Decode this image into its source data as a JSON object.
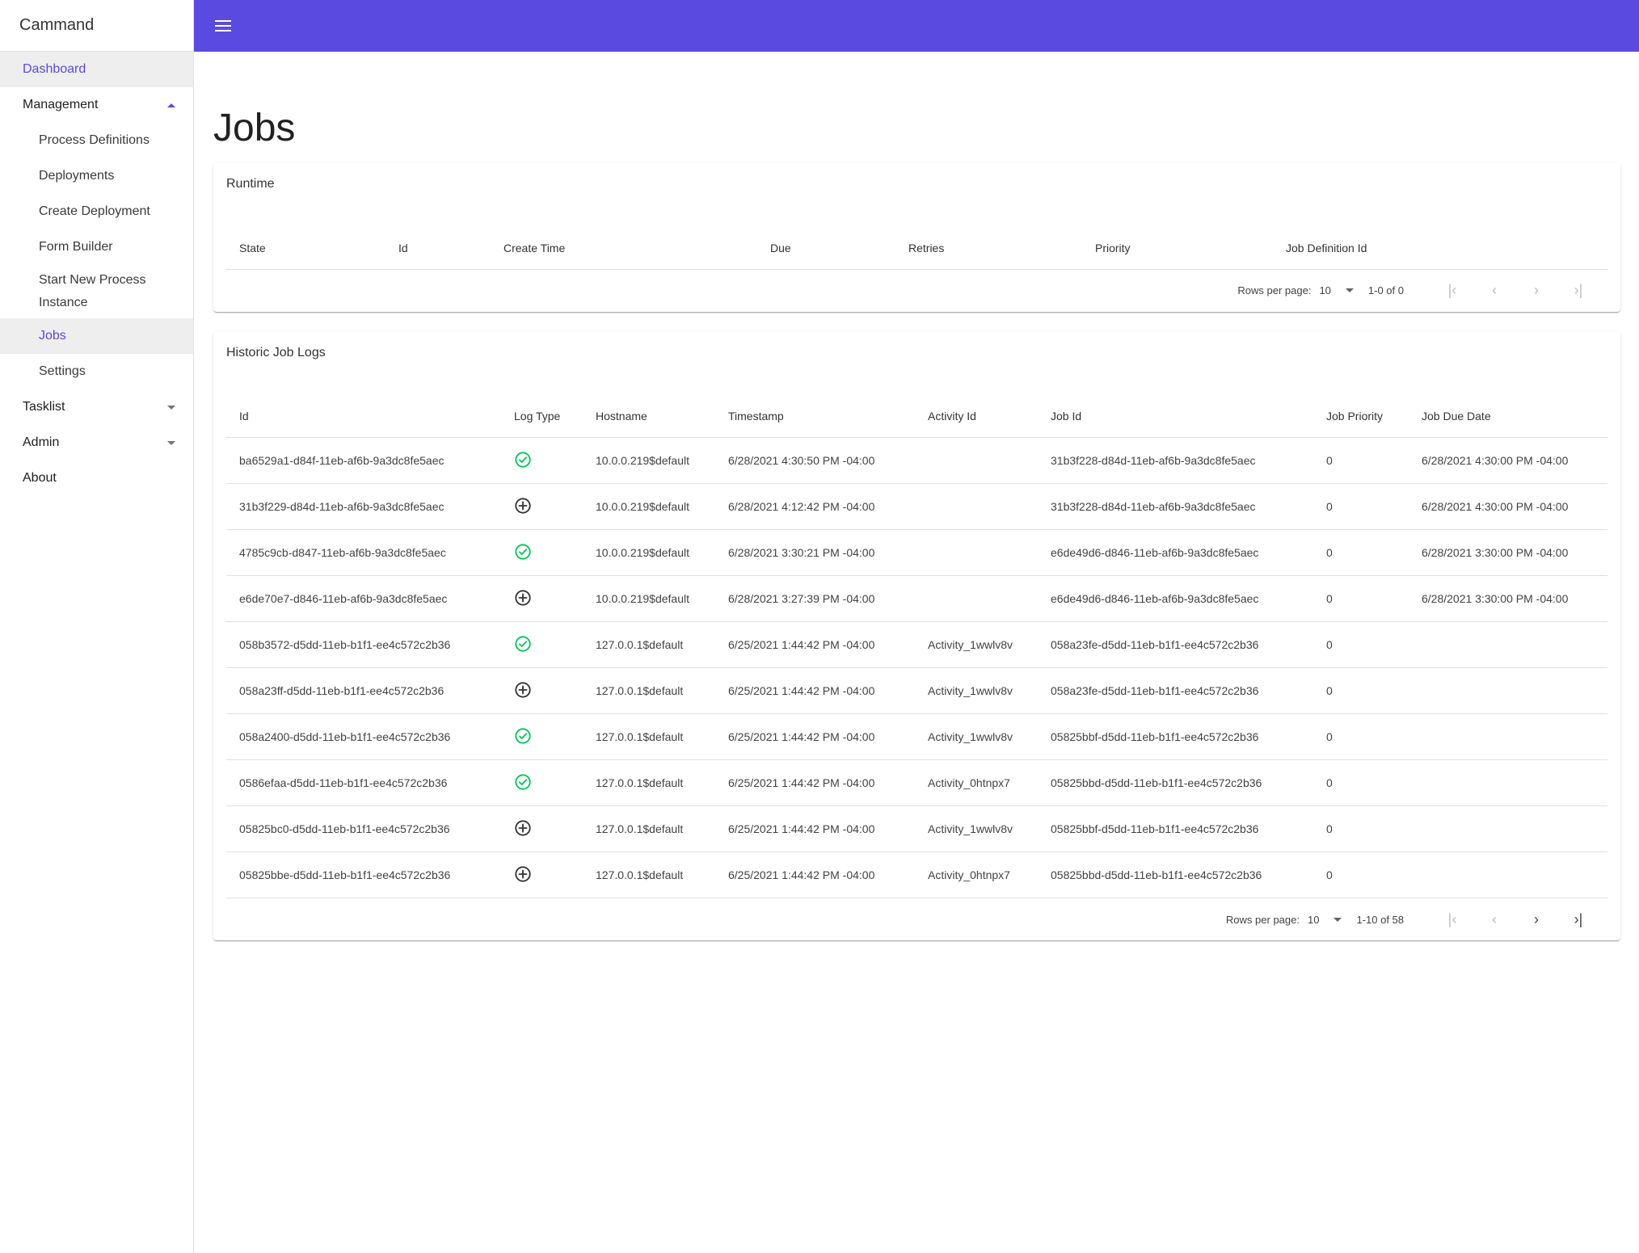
{
  "app": {
    "brand": "Cammand",
    "accent_color": "#5b4adf"
  },
  "sidebar": {
    "items": [
      {
        "label": "Dashboard",
        "level": 0,
        "active": true
      },
      {
        "label": "Management",
        "level": 0,
        "expanded": true
      },
      {
        "label": "Process Definitions",
        "level": 1
      },
      {
        "label": "Deployments",
        "level": 1
      },
      {
        "label": "Create Deployment",
        "level": 1
      },
      {
        "label": "Form Builder",
        "level": 1
      },
      {
        "label": "Start New Process Instance",
        "level": 1
      },
      {
        "label": "Jobs",
        "level": 1,
        "active": true
      },
      {
        "label": "Settings",
        "level": 1
      },
      {
        "label": "Tasklist",
        "level": 0,
        "expanded": false
      },
      {
        "label": "Admin",
        "level": 0,
        "expanded": false
      },
      {
        "label": "About",
        "level": 0
      }
    ]
  },
  "topbar": {
    "menu_icon": "hamburger-menu-icon"
  },
  "page": {
    "title": "Jobs"
  },
  "runtime": {
    "title": "Runtime",
    "columns": [
      "State",
      "Id",
      "Create Time",
      "Due",
      "Retries",
      "Priority",
      "Job Definition Id"
    ],
    "rows": [],
    "pagination": {
      "rows_per_page_label": "Rows per page:",
      "rows_per_page": "10",
      "range": "1-0 of 0"
    }
  },
  "historic": {
    "title": "Historic Job Logs",
    "columns": [
      "Id",
      "Log Type",
      "Hostname",
      "Timestamp",
      "Activity Id",
      "Job Id",
      "Job Priority",
      "Job Due Date"
    ],
    "rows": [
      {
        "id": "ba6529a1-d84f-11eb-af6b-9a3dc8fe5aec",
        "log_type": "success",
        "hostname": "10.0.0.219$default",
        "timestamp": "6/28/2021 4:30:50 PM -04:00",
        "activity_id": "",
        "job_id": "31b3f228-d84d-11eb-af6b-9a3dc8fe5aec",
        "job_priority": "0",
        "job_due_date": "6/28/2021 4:30:00 PM -04:00"
      },
      {
        "id": "31b3f229-d84d-11eb-af6b-9a3dc8fe5aec",
        "log_type": "created",
        "hostname": "10.0.0.219$default",
        "timestamp": "6/28/2021 4:12:42 PM -04:00",
        "activity_id": "",
        "job_id": "31b3f228-d84d-11eb-af6b-9a3dc8fe5aec",
        "job_priority": "0",
        "job_due_date": "6/28/2021 4:30:00 PM -04:00"
      },
      {
        "id": "4785c9cb-d847-11eb-af6b-9a3dc8fe5aec",
        "log_type": "success",
        "hostname": "10.0.0.219$default",
        "timestamp": "6/28/2021 3:30:21 PM -04:00",
        "activity_id": "",
        "job_id": "e6de49d6-d846-11eb-af6b-9a3dc8fe5aec",
        "job_priority": "0",
        "job_due_date": "6/28/2021 3:30:00 PM -04:00"
      },
      {
        "id": "e6de70e7-d846-11eb-af6b-9a3dc8fe5aec",
        "log_type": "created",
        "hostname": "10.0.0.219$default",
        "timestamp": "6/28/2021 3:27:39 PM -04:00",
        "activity_id": "",
        "job_id": "e6de49d6-d846-11eb-af6b-9a3dc8fe5aec",
        "job_priority": "0",
        "job_due_date": "6/28/2021 3:30:00 PM -04:00"
      },
      {
        "id": "058b3572-d5dd-11eb-b1f1-ee4c572c2b36",
        "log_type": "success",
        "hostname": "127.0.0.1$default",
        "timestamp": "6/25/2021 1:44:42 PM -04:00",
        "activity_id": "Activity_1wwlv8v",
        "job_id": "058a23fe-d5dd-11eb-b1f1-ee4c572c2b36",
        "job_priority": "0",
        "job_due_date": ""
      },
      {
        "id": "058a23ff-d5dd-11eb-b1f1-ee4c572c2b36",
        "log_type": "created",
        "hostname": "127.0.0.1$default",
        "timestamp": "6/25/2021 1:44:42 PM -04:00",
        "activity_id": "Activity_1wwlv8v",
        "job_id": "058a23fe-d5dd-11eb-b1f1-ee4c572c2b36",
        "job_priority": "0",
        "job_due_date": ""
      },
      {
        "id": "058a2400-d5dd-11eb-b1f1-ee4c572c2b36",
        "log_type": "success",
        "hostname": "127.0.0.1$default",
        "timestamp": "6/25/2021 1:44:42 PM -04:00",
        "activity_id": "Activity_1wwlv8v",
        "job_id": "05825bbf-d5dd-11eb-b1f1-ee4c572c2b36",
        "job_priority": "0",
        "job_due_date": ""
      },
      {
        "id": "0586efaa-d5dd-11eb-b1f1-ee4c572c2b36",
        "log_type": "success",
        "hostname": "127.0.0.1$default",
        "timestamp": "6/25/2021 1:44:42 PM -04:00",
        "activity_id": "Activity_0htnpx7",
        "job_id": "05825bbd-d5dd-11eb-b1f1-ee4c572c2b36",
        "job_priority": "0",
        "job_due_date": ""
      },
      {
        "id": "05825bc0-d5dd-11eb-b1f1-ee4c572c2b36",
        "log_type": "created",
        "hostname": "127.0.0.1$default",
        "timestamp": "6/25/2021 1:44:42 PM -04:00",
        "activity_id": "Activity_1wwlv8v",
        "job_id": "05825bbf-d5dd-11eb-b1f1-ee4c572c2b36",
        "job_priority": "0",
        "job_due_date": ""
      },
      {
        "id": "05825bbe-d5dd-11eb-b1f1-ee4c572c2b36",
        "log_type": "created",
        "hostname": "127.0.0.1$default",
        "timestamp": "6/25/2021 1:44:42 PM -04:00",
        "activity_id": "Activity_0htnpx7",
        "job_id": "05825bbd-d5dd-11eb-b1f1-ee4c572c2b36",
        "job_priority": "0",
        "job_due_date": ""
      }
    ],
    "log_type_icons": {
      "success": {
        "icon": "check-circle-icon",
        "color": "#00c853"
      },
      "created": {
        "icon": "add-circle-icon",
        "color": "#333333"
      }
    },
    "pagination": {
      "rows_per_page_label": "Rows per page:",
      "rows_per_page": "10",
      "range": "1-10 of 58"
    }
  },
  "pagination_icons": {
    "first": "first-page-icon",
    "prev": "chevron-left-icon",
    "next": "chevron-right-icon",
    "last": "last-page-icon"
  }
}
